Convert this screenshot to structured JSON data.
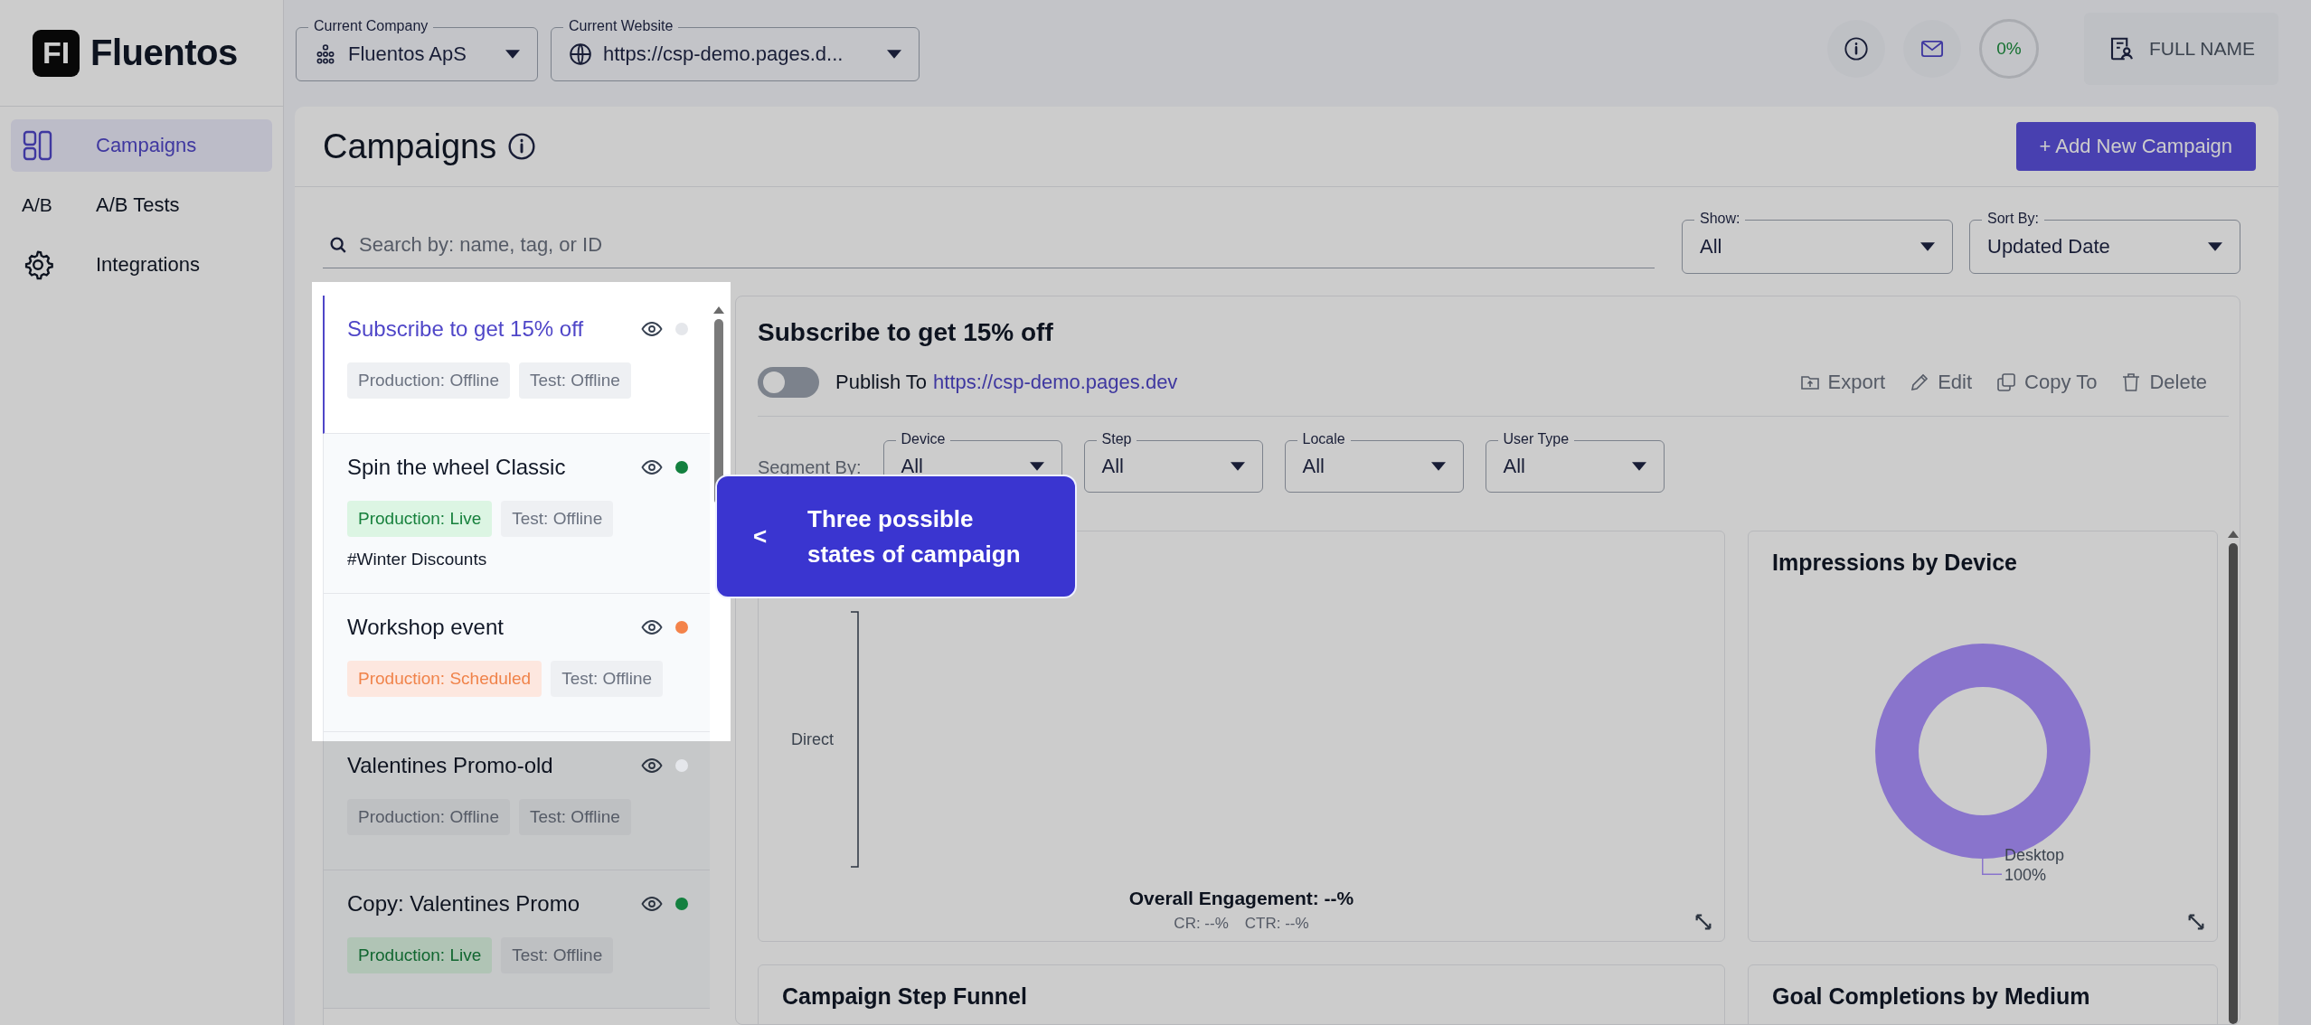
{
  "brand": {
    "mark": "FI",
    "name": "Fluentos"
  },
  "sidebar": {
    "items": [
      {
        "label": "Campaigns",
        "kind": "layout",
        "selected": true
      },
      {
        "label": "A/B Tests",
        "kind": "text",
        "icon_text": "A/B",
        "selected": false
      },
      {
        "label": "Integrations",
        "kind": "gear",
        "selected": false
      }
    ]
  },
  "top_bar": {
    "selectors": [
      {
        "label": "Current Company",
        "value": "Fluentos ApS",
        "kind": "company"
      },
      {
        "label": "Current Website",
        "value": "https://csp-demo.pages.d...",
        "kind": "website"
      }
    ],
    "progress": "0%",
    "user": "FULL NAME"
  },
  "page": {
    "title": "Campaigns",
    "add_button": "+ Add New Campaign",
    "search": {
      "placeholder": "Search by: name, tag, or ID"
    },
    "filters": [
      {
        "label": "Show:",
        "value": "All"
      },
      {
        "label": "Sort By:",
        "value": "Updated Date"
      }
    ]
  },
  "campaigns": [
    {
      "name": "Subscribe to get 15% off",
      "selected": true,
      "color": "#e5e7eb",
      "tags": [
        {
          "text": "Production: Offline",
          "kind": "offline"
        },
        {
          "text": "Test: Offline",
          "kind": "offline"
        }
      ]
    },
    {
      "name": "Spin the wheel Classic",
      "selected": false,
      "color": "#13803f",
      "tags": [
        {
          "text": "Production: Live",
          "kind": "live"
        },
        {
          "text": "Test: Offline",
          "kind": "offline"
        }
      ],
      "hashtag": "#Winter Discounts"
    },
    {
      "name": "Workshop event",
      "selected": false,
      "color": "#f4834a",
      "tags": [
        {
          "text": "Production: Scheduled",
          "kind": "scheduled"
        },
        {
          "text": "Test: Offline",
          "kind": "offline"
        }
      ]
    },
    {
      "name": "Valentines Promo-old",
      "selected": false,
      "color": "#e5e7eb",
      "tags": [
        {
          "text": "Production: Offline",
          "kind": "offline"
        },
        {
          "text": "Test: Offline",
          "kind": "offline"
        }
      ]
    },
    {
      "name": "Copy: Valentines Promo",
      "selected": false,
      "color": "#13803f",
      "tags": [
        {
          "text": "Production: Live",
          "kind": "live"
        },
        {
          "text": "Test: Offline",
          "kind": "offline"
        }
      ]
    }
  ],
  "detail": {
    "title": "Subscribe to get 15% off",
    "publish": {
      "on": false,
      "label": "Publish To",
      "link": "https://csp-demo.pages.dev"
    },
    "actions": [
      {
        "label": "Export",
        "kind": "export"
      },
      {
        "label": "Edit",
        "kind": "edit"
      },
      {
        "label": "Copy To",
        "kind": "copy"
      },
      {
        "label": "Delete",
        "kind": "delete"
      }
    ],
    "segment_label": "Segment By:",
    "segments": [
      {
        "label": "Device",
        "value": "All"
      },
      {
        "label": "Step",
        "value": "All"
      },
      {
        "label": "Locale",
        "value": "All"
      },
      {
        "label": "User Type",
        "value": "All"
      }
    ],
    "engagement": {
      "category": "Direct",
      "title": "Overall Engagement: --%",
      "rates": [
        "CR: --%",
        "CTR: --%"
      ]
    },
    "device_chart": {
      "title": "Impressions by Device",
      "legend": [
        {
          "label": "Desktop",
          "share": "100%"
        }
      ]
    },
    "bottom_cards": [
      "Campaign Step Funnel",
      "Goal Completions by Medium"
    ]
  },
  "tour_tip": {
    "arrow": "<",
    "text": "Three possible states of campaign"
  }
}
